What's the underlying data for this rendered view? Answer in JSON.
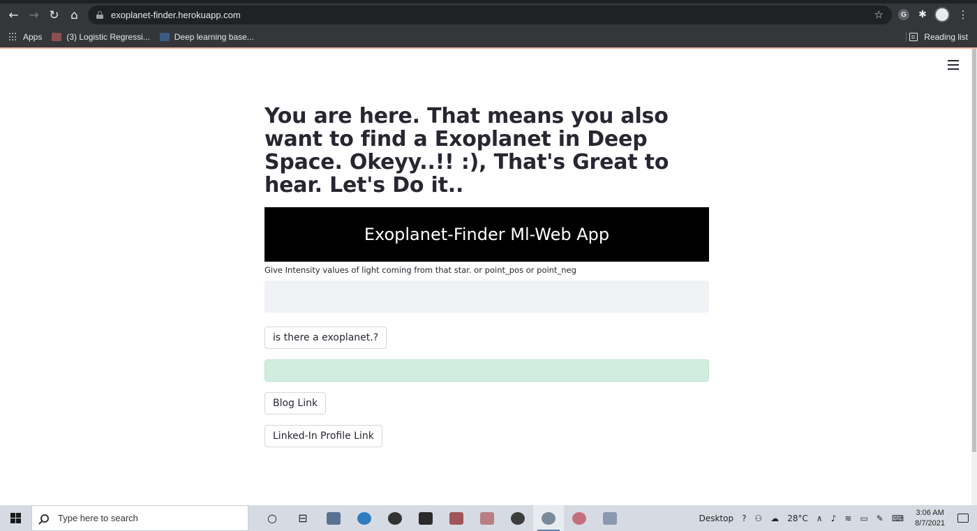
{
  "browser": {
    "url": "exoplanet-finder.herokuapp.com",
    "bookmarks": [
      {
        "label": "Apps"
      },
      {
        "label": "(3) Logistic Regressi..."
      },
      {
        "label": "Deep learning base..."
      }
    ],
    "reading_list": "Reading list"
  },
  "page": {
    "headline": "You are here. That means you also want to find a Exoplanet in Deep Space. Okeyy..!! :), That's Great to hear. Let's Do it..",
    "banner_title": "Exoplanet-Finder Ml-Web App",
    "input_label": "Give Intensity values of light coming from that star. or point_pos or point_neg",
    "input_value": "",
    "predict_button": "is there a exoplanet.?",
    "result_text": "",
    "blog_button": "Blog Link",
    "linkedin_button": "Linked-In Profile Link"
  },
  "taskbar": {
    "search_placeholder": "Type here to search",
    "desktop_label": "Desktop",
    "temperature": "28°C",
    "time": "3:06 AM",
    "date": "8/7/2021"
  },
  "colors": {
    "banner_bg": "#000000",
    "input_bg": "#f0f2f6",
    "success_bg": "#d1ede0",
    "text": "#262730"
  }
}
